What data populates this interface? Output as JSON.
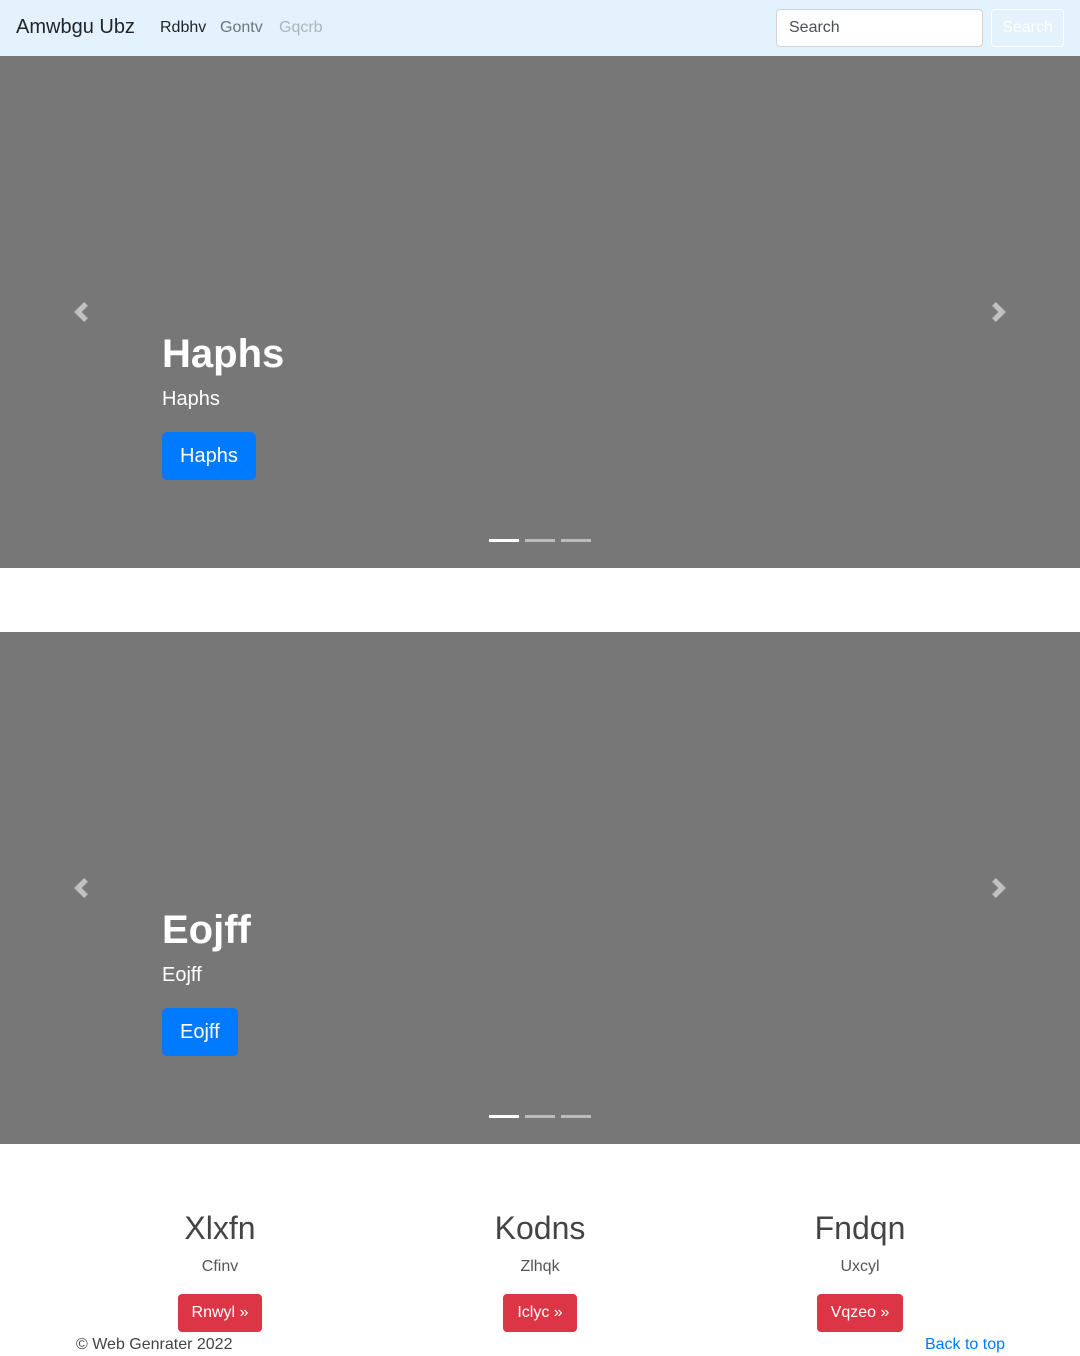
{
  "navbar": {
    "brand": "Amwbgu Ubz",
    "links": [
      {
        "label": "Rdbhv",
        "state": "active"
      },
      {
        "label": "Gontv",
        "state": "normal"
      },
      {
        "label": "Gqcrb",
        "state": "disabled"
      }
    ],
    "search_placeholder": "Search",
    "search_button": "Search"
  },
  "carousels": [
    {
      "heading": "Haphs",
      "text": "Haphs",
      "button": "Haphs",
      "indicator_count": 3,
      "active_indicator": 0
    },
    {
      "heading": "Eojff",
      "text": "Eojff",
      "button": "Eojff",
      "indicator_count": 3,
      "active_indicator": 0
    }
  ],
  "features": [
    {
      "title": "Xlxfn",
      "text": "Cfinv",
      "button": "Rnwyl »"
    },
    {
      "title": "Kodns",
      "text": "Zlhqk",
      "button": "Iclyc »"
    },
    {
      "title": "Fndqn",
      "text": "Uxcyl",
      "button": "Vqzeo »"
    }
  ],
  "footer": {
    "copyright": "© Web Genrater 2022",
    "back_to_top": "Back to top"
  },
  "colors": {
    "navbar_bg": "#e3f2fd",
    "carousel_bg": "#777777",
    "primary": "#007bff",
    "danger": "#dc3545"
  },
  "icons": {
    "prev": "chevron-left-icon",
    "next": "chevron-right-icon"
  }
}
